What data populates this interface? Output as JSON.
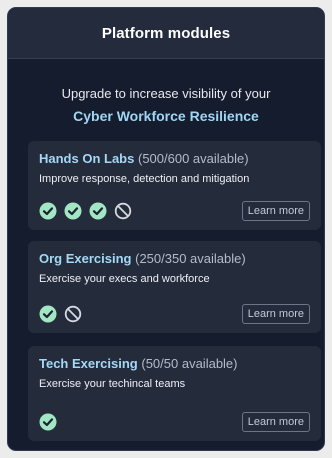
{
  "header": {
    "title": "Platform modules"
  },
  "intro": {
    "line1": "Upgrade to increase visibility of your",
    "line2": "Cyber Workforce Resilience"
  },
  "colors": {
    "check": "#a2e6c3",
    "check_mark": "#1b2232",
    "blocked": "#d6d9df",
    "accent": "#9ed6f4"
  },
  "modules": [
    {
      "name": "Hands On Labs",
      "availability": "(500/600 available)",
      "description": "Improve response, detection and mitigation",
      "status_icons": [
        "check-icon",
        "check-icon",
        "check-icon",
        "blocked-icon"
      ],
      "button": "Learn more"
    },
    {
      "name": "Org Exercising",
      "availability": "(250/350 available)",
      "description": "Exercise your execs and workforce",
      "status_icons": [
        "check-icon",
        "blocked-icon"
      ],
      "button": "Learn more"
    },
    {
      "name": "Tech Exercising",
      "availability": "(50/50 available)",
      "description": "Exercise your techincal teams",
      "status_icons": [
        "check-icon"
      ],
      "button": "Learn more"
    }
  ]
}
